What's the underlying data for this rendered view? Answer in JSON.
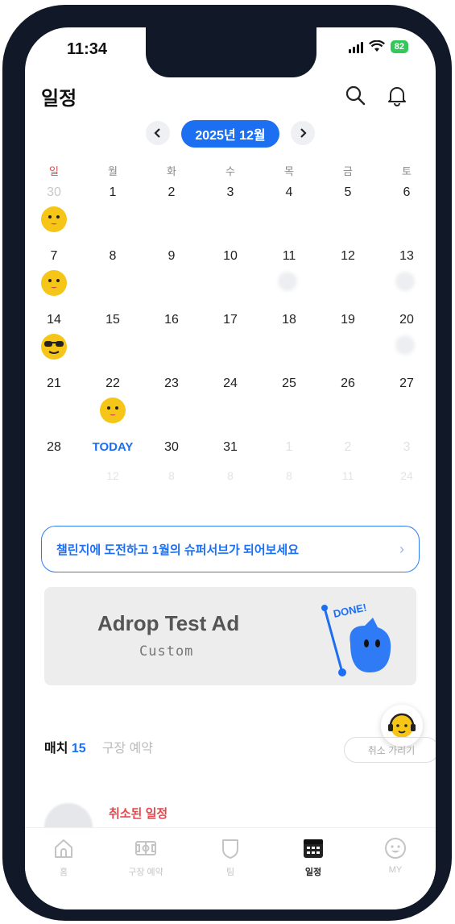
{
  "status_bar": {
    "time": "11:34",
    "battery": "82"
  },
  "header": {
    "title": "일정"
  },
  "calendar": {
    "month_label": "2025년 12월",
    "weekdays": [
      "일",
      "월",
      "화",
      "수",
      "목",
      "금",
      "토"
    ],
    "days": [
      "30",
      "1",
      "2",
      "3",
      "4",
      "5",
      "6",
      "7",
      "8",
      "9",
      "10",
      "11",
      "12",
      "13",
      "14",
      "15",
      "16",
      "17",
      "18",
      "19",
      "20",
      "21",
      "22",
      "23",
      "24",
      "25",
      "26",
      "27",
      "28",
      "TODAY",
      "30",
      "31",
      "1",
      "2",
      "3"
    ],
    "next_row": [
      "",
      "12",
      "8",
      "8",
      "8",
      "11",
      "24"
    ]
  },
  "banner": {
    "text": "챌린지에 도전하고 1월의 슈퍼서브가 되어보세요",
    "chevron": "›"
  },
  "ad": {
    "title": "Adrop Test Ad",
    "subtitle": "Custom",
    "art_text": "DONE!"
  },
  "schedule_tabs": [
    {
      "label": "매치",
      "count": "15"
    },
    {
      "label": "구장 예약"
    }
  ],
  "cancel_filter": "취소 가리기",
  "cancelled_item": {
    "label": "취소된 일정"
  },
  "bottom_nav": [
    {
      "label": "홈",
      "icon": "home-icon"
    },
    {
      "label": "구장 예약",
      "icon": "stadium-icon"
    },
    {
      "label": "팀",
      "icon": "shield-icon"
    },
    {
      "label": "일정",
      "icon": "calendar-icon"
    },
    {
      "label": "MY",
      "icon": "smile-face-icon"
    }
  ],
  "colors": {
    "accent": "#1d6ff2",
    "sunday": "#e5484d",
    "emoji": "#f5c518"
  }
}
